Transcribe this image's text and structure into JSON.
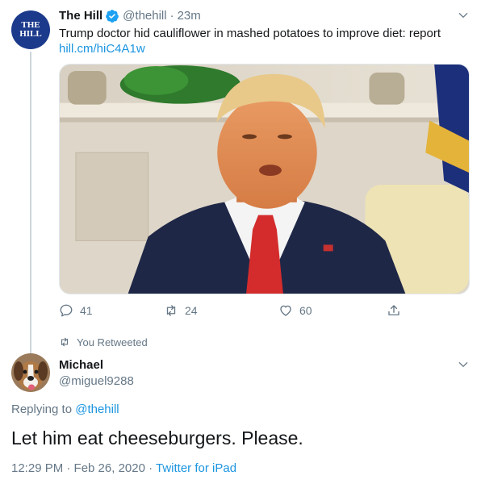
{
  "tweet": {
    "author_name": "The Hill",
    "handle": "@thehill",
    "separator": "·",
    "time": "23m",
    "text": "Trump doctor hid cauliflower in mashed potatoes to improve diet: report",
    "link": "hill.cm/hiC4A1w",
    "avatar_lines": [
      "THE",
      "HILL"
    ],
    "replies": "41",
    "retweets": "24",
    "likes": "60",
    "retweet_note": "You Retweeted"
  },
  "reply": {
    "author_name": "Michael",
    "handle": "@miguel9288",
    "replying_prefix": "Replying to",
    "replying_to": "@thehill",
    "text": "Let him eat cheeseburgers. Please.",
    "timestamp": "12:29 PM · Feb 26, 2020 · ",
    "source": "Twitter for iPad"
  },
  "colors": {
    "accent": "#1b95e0",
    "muted": "#657786",
    "verified": "#1da1f2",
    "hill_brand": "#1c3a8c"
  },
  "icons": [
    "verified-badge-icon",
    "chevron-down-icon",
    "reply-icon",
    "retweet-icon",
    "like-icon",
    "share-icon"
  ]
}
